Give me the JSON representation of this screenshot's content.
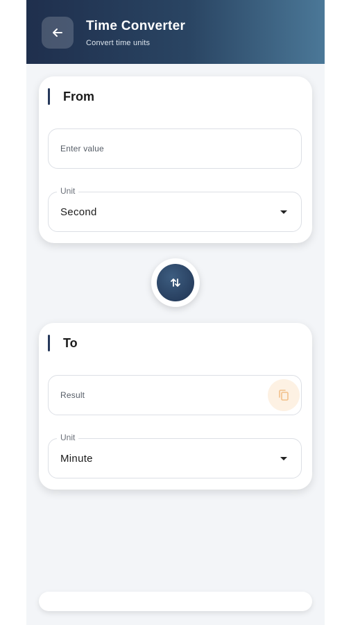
{
  "header": {
    "title": "Time Converter",
    "subtitle": "Convert time units"
  },
  "from_card": {
    "title": "From",
    "input_placeholder": "Enter value",
    "unit_label": "Unit",
    "unit_value": "Second"
  },
  "to_card": {
    "title": "To",
    "result_placeholder": "Result",
    "unit_label": "Unit",
    "unit_value": "Minute"
  },
  "icons": {
    "back": "arrow-left-icon",
    "swap": "swap-vertical-icon",
    "copy": "copy-icon",
    "dropdown": "dropdown-caret-icon"
  },
  "colors": {
    "header_start": "#1f2f4d",
    "header_end": "#4b7898",
    "accent": "#26385a",
    "copy_bg": "#fdf1e3",
    "copy_icon": "#f2c08a"
  }
}
